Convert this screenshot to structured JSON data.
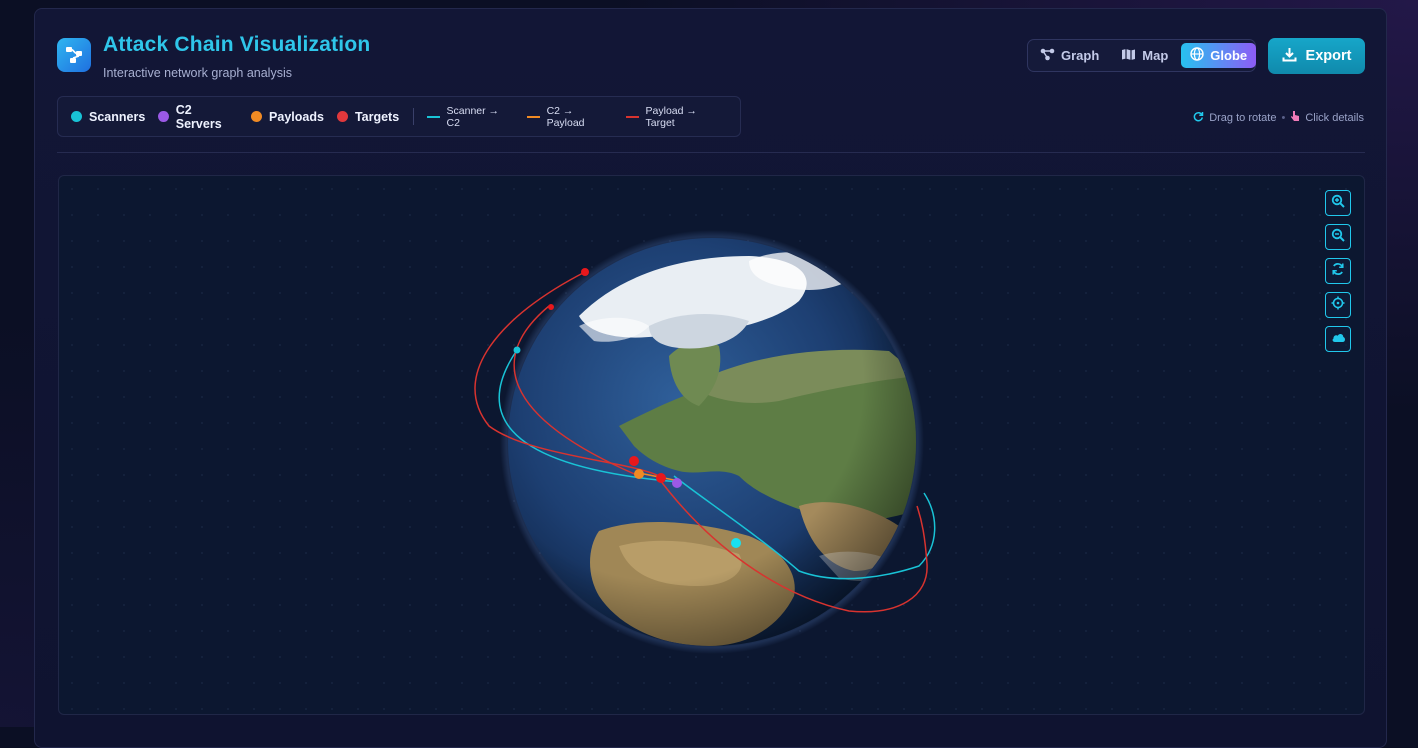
{
  "header": {
    "title": "Attack Chain Visualization",
    "subtitle": "Interactive network graph analysis"
  },
  "view_switch": {
    "graph_label": "Graph",
    "map_label": "Map",
    "globe_label": "Globe",
    "active": "globe"
  },
  "export_label": "Export",
  "legend": {
    "nodes": [
      {
        "label": "Scanners",
        "color": "#19c3d6"
      },
      {
        "label": "C2 Servers",
        "color": "#9b59e6"
      },
      {
        "label": "Payloads",
        "color": "#f08a24"
      },
      {
        "label": "Targets",
        "color": "#e0383c"
      }
    ],
    "lines": [
      {
        "label": "Scanner → C2",
        "color": "#19c3d6"
      },
      {
        "label": "C2 → Payload",
        "color": "#f08a24"
      },
      {
        "label": "Payload → Target",
        "color": "#d8332f"
      }
    ]
  },
  "hints": {
    "rotate": "Drag to rotate",
    "details": "Click details"
  },
  "controls": [
    "zoom-in-icon",
    "zoom-out-icon",
    "refresh-icon",
    "crosshair-icon",
    "cloud-icon"
  ],
  "accent_color": "#21c8ec"
}
